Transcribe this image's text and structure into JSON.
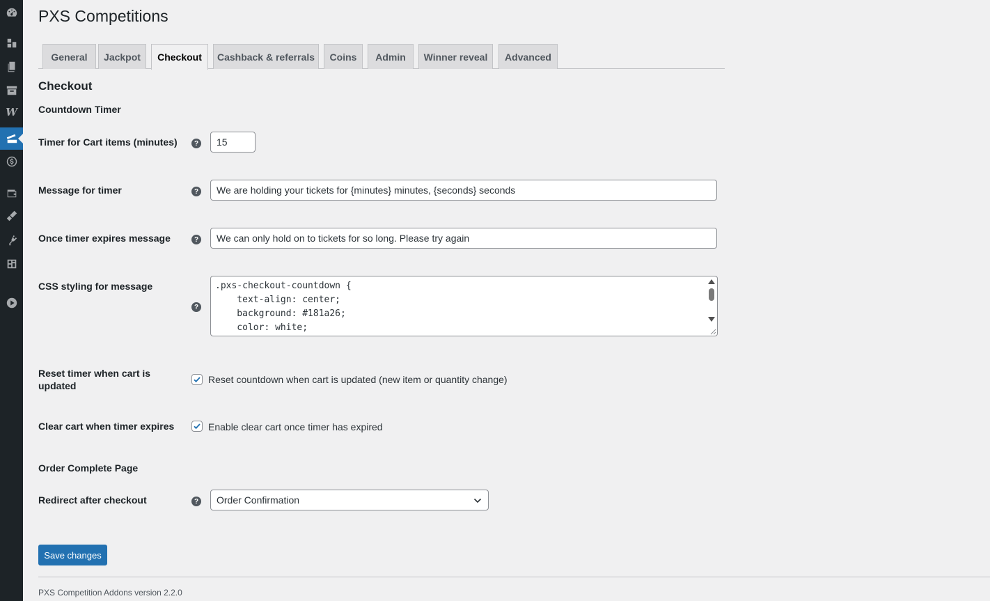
{
  "sidebar": {
    "icons": [
      "dashboard-icon",
      "media-icon",
      "pages-icon",
      "archive-icon",
      "woocommerce-icon",
      "competitions-icon",
      "dollar-icon",
      "wallet-icon",
      "appearance-icon",
      "plugins-icon",
      "layout-icon",
      "play-icon"
    ],
    "active": "competitions-icon",
    "woo_glyph": "W"
  },
  "page": {
    "title": "PXS Competitions"
  },
  "tabs": [
    {
      "label": "General"
    },
    {
      "label": "Jackpot"
    },
    {
      "label": "Checkout"
    },
    {
      "label": "Cashback & referrals"
    },
    {
      "label": "Coins"
    },
    {
      "label": "Admin"
    },
    {
      "label": "Winner reveal"
    },
    {
      "label": "Advanced"
    }
  ],
  "active_tab": "Checkout",
  "section": {
    "title": "Checkout",
    "countdown_heading": "Countdown Timer",
    "order_heading": "Order Complete Page"
  },
  "fields": {
    "timer": {
      "label": "Timer for Cart items (minutes)",
      "value": "15"
    },
    "message": {
      "label": "Message for timer",
      "value": "We are holding your tickets for {minutes} minutes, {seconds} seconds"
    },
    "expires": {
      "label": "Once timer expires message",
      "value": "We can only hold on to tickets for so long. Please try again"
    },
    "css": {
      "label": "CSS styling for message",
      "value": ".pxs-checkout-countdown {\n    text-align: center;\n    background: #181a26;\n    color: white;"
    },
    "reset": {
      "label": "Reset timer when cart is updated",
      "checkbox_label": "Reset countdown when cart is updated (new item or quantity change)",
      "checked": true
    },
    "clear": {
      "label": "Clear cart when timer expires",
      "checkbox_label": "Enable clear cart once timer has expired",
      "checked": true
    },
    "redirect": {
      "label": "Redirect after checkout",
      "selected": "Order Confirmation"
    }
  },
  "help_glyph": "?",
  "buttons": {
    "save": "Save changes"
  },
  "footer": {
    "version_text": "PXS Competition Addons version 2.2.0"
  },
  "colors": {
    "accent": "#2271b1",
    "sidebar": "#1d2327",
    "background": "#f0f0f1"
  }
}
